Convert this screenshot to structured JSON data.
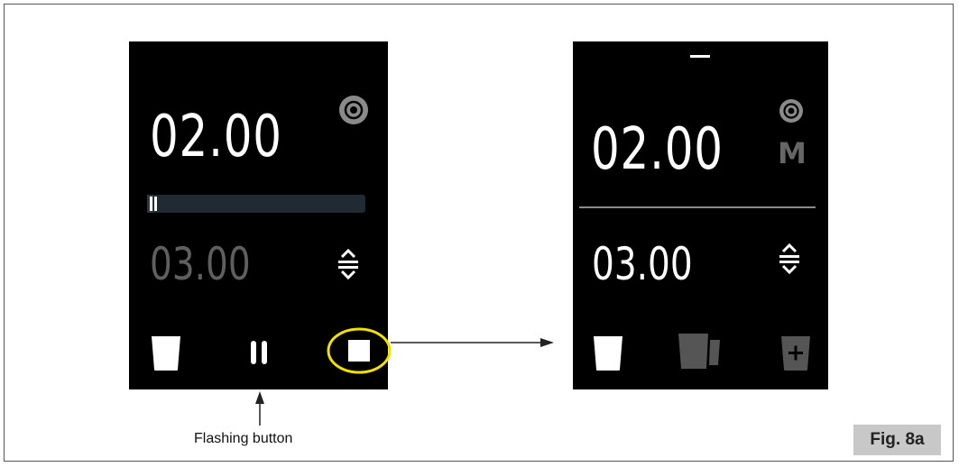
{
  "left_screen": {
    "current_time": "02.00",
    "set_time": "03.00",
    "progress_fraction": 0.03,
    "icons": [
      "cycle-icon",
      "adjust-arrows-icon",
      "glass-icon",
      "pause-icon",
      "stop-icon"
    ]
  },
  "right_screen": {
    "current_time": "02.00",
    "set_time": "03.00",
    "mode_letter": "M",
    "icons": [
      "cycle-icon",
      "adjust-arrows-icon",
      "glass-icon",
      "jug-icon",
      "add-container-icon"
    ]
  },
  "annotation": {
    "caption": "Flashing button",
    "highlight_color": "#f2e000"
  },
  "figure_label": "Fig. 8a",
  "colors": {
    "screen_bg": "#000000",
    "text": "#ffffff",
    "dim": "#5f5f5f",
    "progress_track": "#1f2a33"
  }
}
